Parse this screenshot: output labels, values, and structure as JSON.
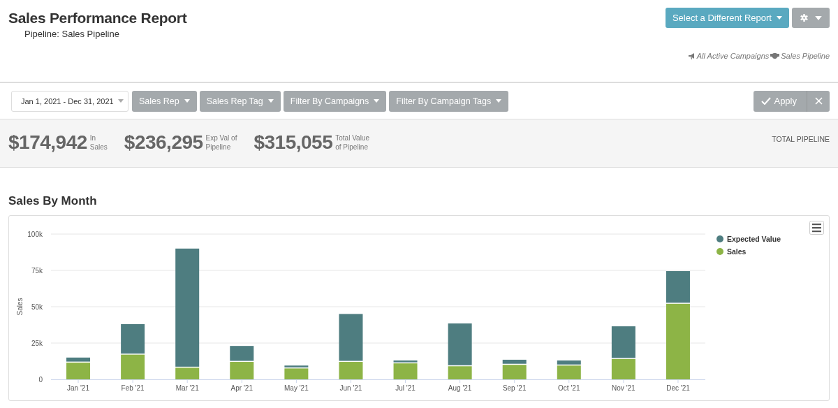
{
  "header": {
    "title": "Sales Performance Report",
    "subtitle": "Pipeline: Sales Pipeline",
    "report_button": "Select a Different Report",
    "context": [
      {
        "kind": "campaigns",
        "label": "All Active Campaigns"
      },
      {
        "kind": "pipeline",
        "label": "Sales Pipeline"
      }
    ]
  },
  "filters": {
    "date_range": "Jan 1, 2021 - Dec 31, 2021",
    "dropdowns": [
      "Sales Rep",
      "Sales Rep Tag",
      "Filter By Campaigns",
      "Filter By Campaign Tags"
    ],
    "apply": "Apply"
  },
  "stats": [
    {
      "value": "$174,942",
      "caption_lines": [
        "In",
        "Sales"
      ]
    },
    {
      "value": "$236,295",
      "caption_lines": [
        "Exp Val of",
        "Pipeline"
      ]
    },
    {
      "value": "$315,055",
      "caption_lines": [
        "Total Value",
        "of Pipeline"
      ]
    }
  ],
  "stats_label": "TOTAL PIPELINE",
  "section": {
    "title": "Sales By Month",
    "chart_data": {
      "type": "bar",
      "stacked": true,
      "grid": true,
      "legend": true,
      "ylabel": "Sales",
      "categories": [
        "Jan '21",
        "Feb '21",
        "Mar '21",
        "Apr '21",
        "May '21",
        "Jun '21",
        "Jul '21",
        "Aug '21",
        "Sep '21",
        "Oct '21",
        "Nov '21",
        "Dec '21"
      ],
      "ylim": [
        0,
        100000
      ],
      "yticks": [
        {
          "value": 0,
          "label": "0"
        },
        {
          "value": 25000,
          "label": "25k"
        },
        {
          "value": 50000,
          "label": "50k"
        },
        {
          "value": 75000,
          "label": "75k"
        },
        {
          "value": 100000,
          "label": "100k"
        }
      ],
      "series": [
        {
          "name": "Expected Value",
          "color": "#4e7d80",
          "values": [
            3500,
            21000,
            82000,
            11000,
            2000,
            33000,
            2000,
            29500,
            3500,
            3500,
            22500,
            22500
          ]
        },
        {
          "name": "Sales",
          "color": "#8db446",
          "values": [
            11500,
            17000,
            8000,
            12000,
            7500,
            12000,
            11000,
            9000,
            10000,
            9500,
            14000,
            52000
          ]
        }
      ]
    }
  }
}
